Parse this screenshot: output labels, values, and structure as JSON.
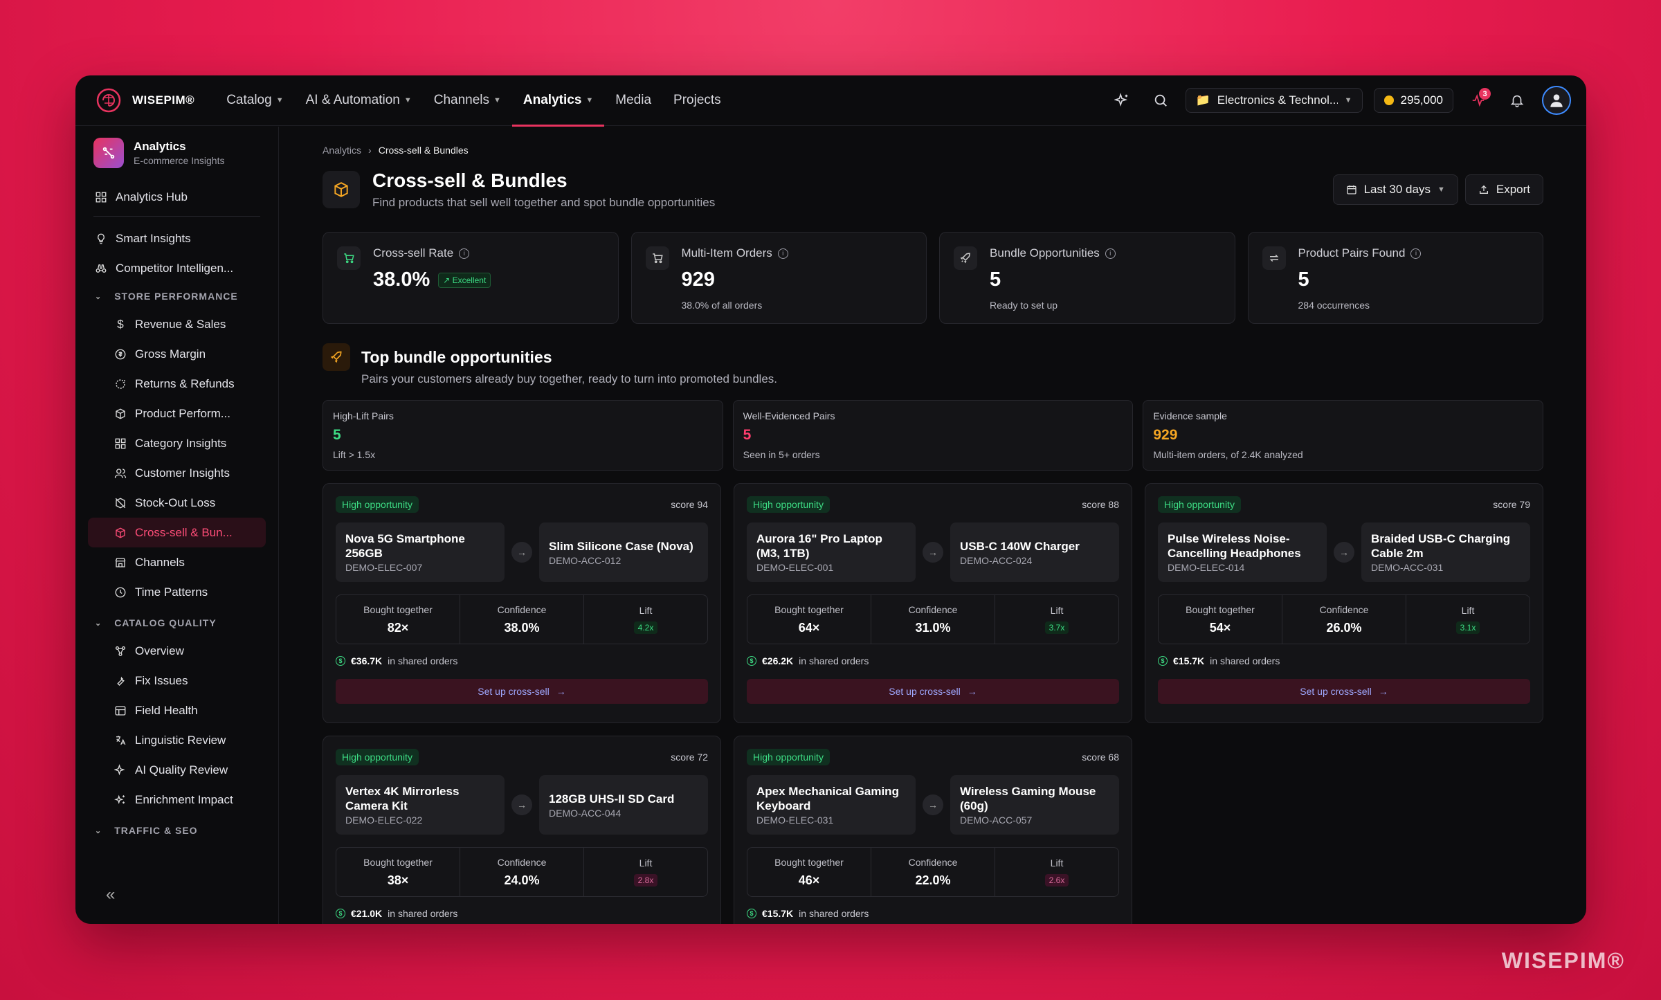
{
  "brand": {
    "name": "WISEPIM®",
    "watermark": "WISEPIM®"
  },
  "nav": [
    {
      "label": "Catalog",
      "dropdown": true
    },
    {
      "label": "AI & Automation",
      "dropdown": true
    },
    {
      "label": "Channels",
      "dropdown": true
    },
    {
      "label": "Analytics",
      "dropdown": true,
      "active": true
    },
    {
      "label": "Media",
      "dropdown": false
    },
    {
      "label": "Projects",
      "dropdown": false
    }
  ],
  "topbar": {
    "workspace": "Electronics & Technol...",
    "credits": "295,000",
    "notifications_count": "3"
  },
  "sidebar": {
    "app_title": "Analytics",
    "app_subtitle": "E-commerce Insights",
    "hub": "Analytics Hub",
    "top_items": [
      "Smart Insights",
      "Competitor Intelligen..."
    ],
    "sections": [
      {
        "title": "STORE PERFORMANCE",
        "items": [
          "Revenue & Sales",
          "Gross Margin",
          "Returns & Refunds",
          "Product Perform...",
          "Category Insights",
          "Customer Insights",
          "Stock-Out Loss",
          "Cross-sell & Bun...",
          "Channels",
          "Time Patterns"
        ]
      },
      {
        "title": "CATALOG QUALITY",
        "items": [
          "Overview",
          "Fix Issues",
          "Field Health",
          "Linguistic Review",
          "AI Quality Review",
          "Enrichment Impact"
        ]
      },
      {
        "title": "TRAFFIC & SEO",
        "items": []
      }
    ],
    "active_item": "Cross-sell & Bun..."
  },
  "breadcrumb": {
    "parent": "Analytics",
    "current": "Cross-sell & Bundles"
  },
  "page": {
    "title": "Cross-sell & Bundles",
    "subtitle": "Find products that sell well together and spot bundle opportunities",
    "date_range": "Last 30 days",
    "export": "Export"
  },
  "kpis": [
    {
      "label": "Cross-sell Rate",
      "value": "38.0%",
      "badge": "↗ Excellent",
      "note": ""
    },
    {
      "label": "Multi-Item Orders",
      "value": "929",
      "badge": "",
      "note": "38.0% of all orders"
    },
    {
      "label": "Bundle Opportunities",
      "value": "5",
      "badge": "",
      "note": "Ready to set up"
    },
    {
      "label": "Product Pairs Found",
      "value": "5",
      "badge": "",
      "note": "284 occurrences"
    }
  ],
  "section": {
    "title": "Top bundle opportunities",
    "subtitle": "Pairs your customers already buy together, ready to turn into promoted bundles."
  },
  "stats": [
    {
      "label": "High-Lift Pairs",
      "value": "5",
      "note": "Lift > 1.5x",
      "color": "#3ddc84"
    },
    {
      "label": "Well-Evidenced Pairs",
      "value": "5",
      "note": "Seen in 5+ orders",
      "color": "#ff3d6e"
    },
    {
      "label": "Evidence sample",
      "value": "929",
      "note": "Multi-item orders, of 2.4K analyzed",
      "color": "#f5a623"
    }
  ],
  "labels": {
    "opportunity": "High opportunity",
    "bought_together": "Bought together",
    "confidence": "Confidence",
    "lift": "Lift",
    "shared_suffix": "in shared orders",
    "cta": "Set up cross-sell"
  },
  "bundles": [
    {
      "score": "score 94",
      "a_name": "Nova 5G Smartphone 256GB",
      "a_sku": "DEMO-ELEC-007",
      "b_name": "Slim Silicone Case (Nova)",
      "b_sku": "DEMO-ACC-012",
      "bought": "82×",
      "confidence": "38.0%",
      "lift": "4.2x",
      "lift_tone": "green",
      "shared": "€36.7K"
    },
    {
      "score": "score 88",
      "a_name": "Aurora 16\" Pro Laptop (M3, 1TB)",
      "a_sku": "DEMO-ELEC-001",
      "b_name": "USB-C 140W Charger",
      "b_sku": "DEMO-ACC-024",
      "bought": "64×",
      "confidence": "31.0%",
      "lift": "3.7x",
      "lift_tone": "green",
      "shared": "€26.2K"
    },
    {
      "score": "score 79",
      "a_name": "Pulse Wireless Noise-Cancelling Headphones",
      "a_sku": "DEMO-ELEC-014",
      "b_name": "Braided USB-C Charging Cable 2m",
      "b_sku": "DEMO-ACC-031",
      "bought": "54×",
      "confidence": "26.0%",
      "lift": "3.1x",
      "lift_tone": "green",
      "shared": "€15.7K"
    },
    {
      "score": "score 72",
      "a_name": "Vertex 4K Mirrorless Camera Kit",
      "a_sku": "DEMO-ELEC-022",
      "b_name": "128GB UHS-II SD Card",
      "b_sku": "DEMO-ACC-044",
      "bought": "38×",
      "confidence": "24.0%",
      "lift": "2.8x",
      "lift_tone": "pink",
      "shared": "€21.0K"
    },
    {
      "score": "score 68",
      "a_name": "Apex Mechanical Gaming Keyboard",
      "a_sku": "DEMO-ELEC-031",
      "b_name": "Wireless Gaming Mouse (60g)",
      "b_sku": "DEMO-ACC-057",
      "bought": "46×",
      "confidence": "22.0%",
      "lift": "2.6x",
      "lift_tone": "pink",
      "shared": "€15.7K"
    }
  ],
  "colors": {
    "accent": "#e8335f",
    "positive": "#3ddc84",
    "link": "#9fa8ff"
  }
}
